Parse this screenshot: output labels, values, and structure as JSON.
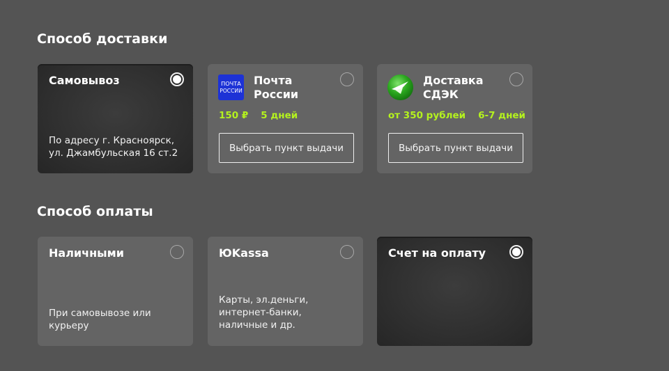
{
  "delivery": {
    "title": "Способ доставки",
    "options": [
      {
        "title": "Самовывоз",
        "description": "По адресу г. Красноярск, ул. Джамбульская 16 ст.2",
        "selected": true
      },
      {
        "title": "Почта России",
        "logo_text": "ПОЧТА РОССИИ",
        "logo": "pochta-rossii-logo",
        "price": "150 ₽",
        "duration": "5 дней",
        "button_label": "Выбрать пункт выдачи",
        "selected": false
      },
      {
        "title": "Доставка СДЭК",
        "logo": "cdek-logo",
        "price": "от 350 рублей",
        "duration": "6-7 дней",
        "button_label": "Выбрать пункт выдачи",
        "selected": false
      }
    ]
  },
  "payment": {
    "title": "Способ оплаты",
    "options": [
      {
        "title": "Наличными",
        "description": "При самовывозе или курьеру",
        "selected": false
      },
      {
        "title": "ЮKassa",
        "description": "Карты, эл.деньги, интернет-банки, наличные и др.",
        "selected": false
      },
      {
        "title": "Счет на оплату",
        "description": "",
        "selected": true
      }
    ]
  },
  "colors": {
    "background": "#545454",
    "card": "#646464",
    "card_selected": "#2f2f2f",
    "accent_green": "#b4f21e",
    "pochta_blue": "#1d32d6",
    "cdek_green": "#2aa61e"
  }
}
